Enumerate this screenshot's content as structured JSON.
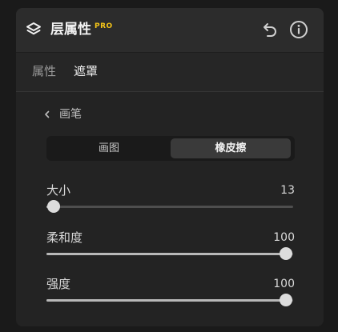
{
  "header": {
    "title": "层属性",
    "badge": "PRO",
    "icon": "layers-icon",
    "undo_icon": "undo-icon",
    "info_icon": "info-icon"
  },
  "tabs": [
    {
      "label": "属性",
      "active": false
    },
    {
      "label": "遮罩",
      "active": true
    }
  ],
  "section": {
    "title": "画笔",
    "icon": "chevron-left-icon"
  },
  "brush_mode": {
    "options": [
      "画图",
      "橡皮擦"
    ],
    "selected": "橡皮擦"
  },
  "sliders": [
    {
      "label": "大小",
      "value": "13",
      "fraction": 0.03
    },
    {
      "label": "柔和度",
      "value": "100",
      "fraction": 0.97
    },
    {
      "label": "强度",
      "value": "100",
      "fraction": 0.97
    }
  ],
  "colors": {
    "badge": "#f5c518",
    "panel": "#232323",
    "header": "#2c2c2c"
  }
}
